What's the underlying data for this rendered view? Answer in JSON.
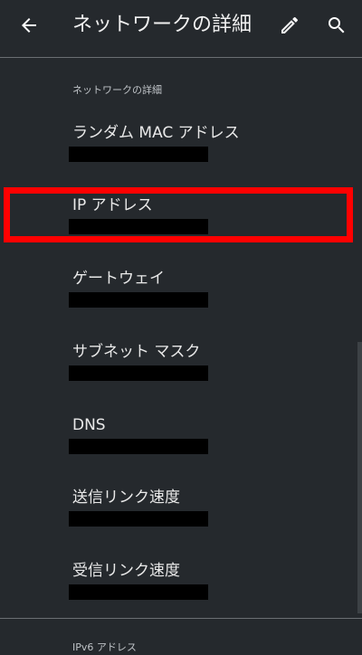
{
  "appbar": {
    "title": "ネットワークの詳細",
    "back_icon": "arrow-back-icon",
    "edit_icon": "pencil-icon",
    "search_icon": "search-icon"
  },
  "section": {
    "header": "ネットワークの詳細",
    "rows": [
      {
        "label": "ランダム MAC アドレス",
        "value_redacted": true
      },
      {
        "label": "IP アドレス",
        "value_redacted": true,
        "highlighted": true
      },
      {
        "label": "ゲートウェイ",
        "value_redacted": true
      },
      {
        "label": "サブネット マスク",
        "value_redacted": true
      },
      {
        "label": "DNS",
        "value_redacted": true
      },
      {
        "label": "送信リンク速度",
        "value_redacted": true
      },
      {
        "label": "受信リンク速度",
        "value_redacted": true
      }
    ]
  },
  "bottom_section": {
    "header": "IPv6 アドレス"
  },
  "colors": {
    "background": "#25292d",
    "highlight": "#ff0000",
    "redaction": "#000000"
  }
}
